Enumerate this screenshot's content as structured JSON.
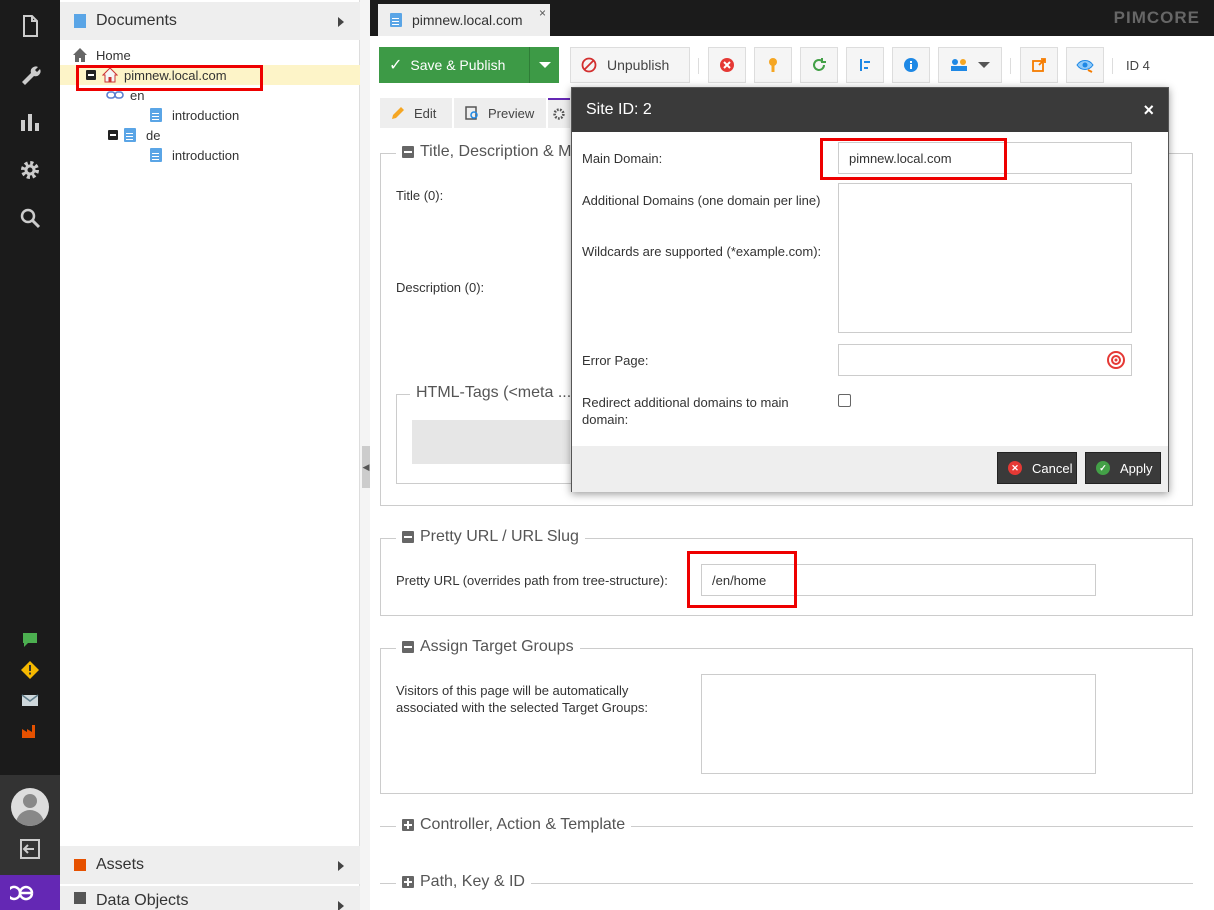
{
  "rail": {
    "icons": [
      "document-icon",
      "wrench-icon",
      "chart-icon",
      "gear-icon",
      "search-icon"
    ],
    "notifications": [
      "chat-icon",
      "warning-icon",
      "mail-icon",
      "factory-icon"
    ]
  },
  "tree": {
    "documents_header": "Documents",
    "assets_header": "Assets",
    "objects_header": "Data Objects",
    "items": [
      {
        "label": "Home"
      },
      {
        "label": "pimnew.local.com"
      },
      {
        "label": "en"
      },
      {
        "label": "introduction"
      },
      {
        "label": "de"
      },
      {
        "label": "introduction"
      }
    ]
  },
  "tabbar": {
    "doc_tab_label": "pimnew.local.com",
    "close": "×",
    "brand": "PIMCORE"
  },
  "toolbar": {
    "save_label": "Save & Publish",
    "unpublish_label": "Unpublish",
    "id_label": "ID 4"
  },
  "subtabs": {
    "edit": "Edit",
    "preview": "Preview"
  },
  "content": {
    "title_section": "Title, Description & M",
    "title_label": "Title (0):",
    "description_label": "Description (0):",
    "html_tags_legend": "HTML-Tags (<meta ...",
    "pretty_url_section": "Pretty URL / URL Slug",
    "pretty_url_label": "Pretty URL (overrides path from tree-structure):",
    "pretty_url_value": "/en/home",
    "target_groups_section": "Assign Target Groups",
    "target_groups_label": "Visitors of this page will be automatically associated with the selected Target Groups:",
    "controller_section": "Controller, Action & Template",
    "path_section": "Path, Key & ID"
  },
  "dialog": {
    "title": "Site ID: 2",
    "close": "×",
    "main_domain_label": "Main Domain:",
    "main_domain_value": "pimnew.local.com",
    "additional_label": "Additional Domains (one domain per line)",
    "wildcards_label": "Wildcards are supported (*example.com):",
    "error_page_label": "Error Page:",
    "redirect_label": "Redirect additional domains to main domain:",
    "redirect_checked": false,
    "cancel_label": "Cancel",
    "apply_label": "Apply"
  }
}
